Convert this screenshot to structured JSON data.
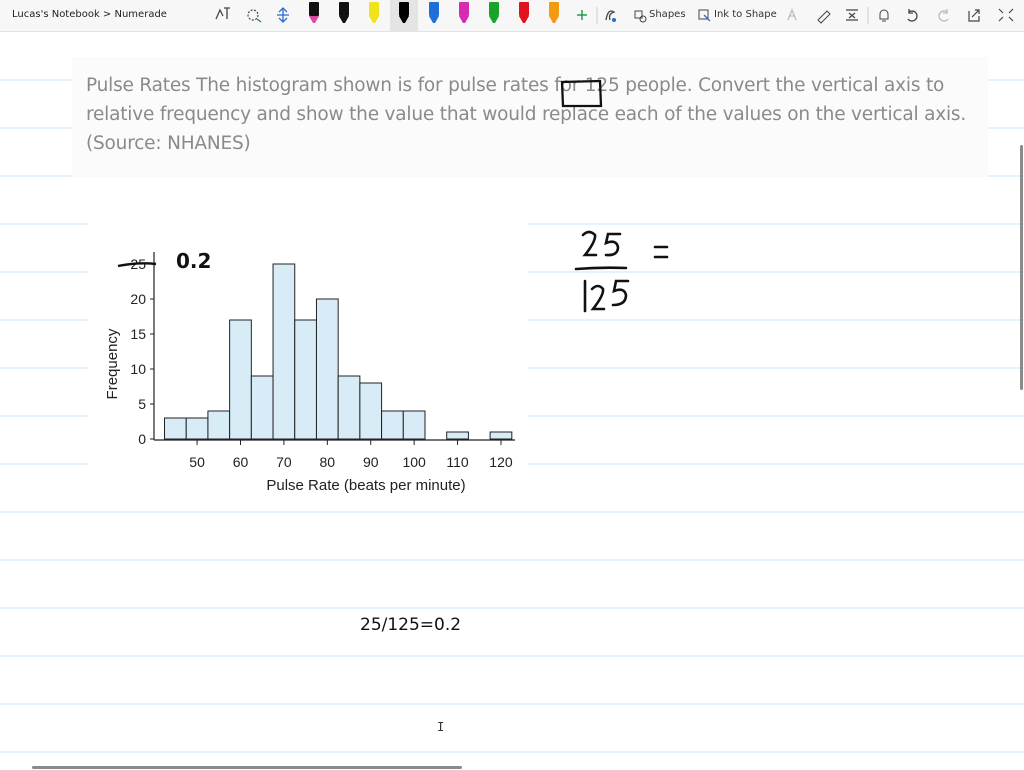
{
  "toolbar": {
    "breadcrumb": "Lucas's Notebook > Numerade",
    "shapes_label": "Shapes",
    "ink_to_shape_label": "Ink to Shape",
    "pens": [
      {
        "name": "pen-black-1",
        "color": "#111111"
      },
      {
        "name": "pen-black-2",
        "color": "#111111"
      },
      {
        "name": "highlighter-yellow",
        "color": "#f2e21a"
      },
      {
        "name": "pen-black-selected",
        "color": "#000000"
      },
      {
        "name": "pen-blue",
        "color": "#1e6fd9"
      },
      {
        "name": "pen-magenta",
        "color": "#d62bb0"
      },
      {
        "name": "pen-green",
        "color": "#1aa32c"
      },
      {
        "name": "pen-red",
        "color": "#e0141e"
      },
      {
        "name": "pen-orange",
        "color": "#f39a12"
      }
    ]
  },
  "question": {
    "text": "Pulse Rates The histogram shown is for pulse rates for 125 people. Convert the vertical axis to relative frequency and show the value that would replace each of the values on the vertical axis. (Source: NHANES)"
  },
  "chart_data": {
    "type": "bar",
    "xlabel": "Pulse Rate (beats per minute)",
    "ylabel": "Frequency",
    "bin_width": 5,
    "bin_starts": [
      42.5,
      47.5,
      52.5,
      57.5,
      62.5,
      67.5,
      72.5,
      77.5,
      82.5,
      87.5,
      92.5,
      97.5,
      102.5,
      107.5,
      112.5,
      117.5
    ],
    "values": [
      3,
      3,
      4,
      17,
      9,
      25,
      17,
      20,
      9,
      8,
      4,
      4,
      0,
      1,
      0,
      1
    ],
    "xticks": [
      50,
      60,
      70,
      80,
      90,
      100,
      110,
      120
    ],
    "yticks": [
      0,
      5,
      10,
      15,
      20,
      25
    ],
    "xlim": [
      41,
      123
    ],
    "ylim": [
      0,
      26
    ],
    "bar_color": "#d8ecf7",
    "annotation": "0.2"
  },
  "notes": {
    "typed_equation": "25/125=0.2"
  }
}
